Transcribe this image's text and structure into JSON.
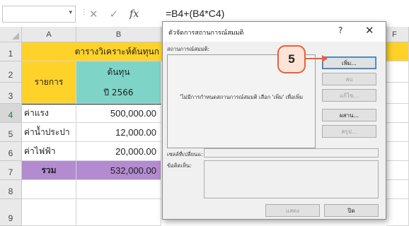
{
  "formula_bar": {
    "name_box": "",
    "cancel_icon": "close-icon",
    "enter_icon": "check-icon",
    "fx_label": "fx",
    "formula": "=B4+(B4*C4)"
  },
  "grid": {
    "columns": [
      "A",
      "B",
      "C",
      "D",
      "E",
      "F"
    ],
    "rows": [
      "1",
      "2",
      "3",
      "4",
      "5",
      "6",
      "7",
      "8",
      "9"
    ],
    "title": "ตารางวิเคราะห์ต้นทุนก",
    "header_item": "รายการ",
    "header_cost": "ต้นทุน",
    "header_year": "ปี 2566",
    "items": [
      {
        "label": "ค่าแรง",
        "value": "500,000.00"
      },
      {
        "label": "ค่าน้ำประปา",
        "value": "12,000.00"
      },
      {
        "label": "ค่าไฟฟ้า",
        "value": "20,000.00"
      }
    ],
    "total_label": "รวม",
    "total_value": "532,000.00"
  },
  "dialog": {
    "title": "ตัวจัดการสถานการณ์สมมติ",
    "help": "?",
    "close": "✕",
    "scenarios_label": "สถานการณ์สมมติ:",
    "empty_message": "'ไม่มีการกำหนดสถานการณ์สมมติ เลือก 'เพิ่ม' เพื่อเพิ่ม",
    "buttons": {
      "add": "เพิ่ม...",
      "delete": "ลบ",
      "edit": "แก้ไข...",
      "merge": "ผสาน...",
      "summary": "สรุป..."
    },
    "changing_cells_label": "เซลล์ที่เปลี่ยนแ:",
    "comment_label": "ข้อคิดเห็น:",
    "show_button": "แสดง",
    "close_button": "ปิด"
  },
  "callout": {
    "step": "5"
  }
}
